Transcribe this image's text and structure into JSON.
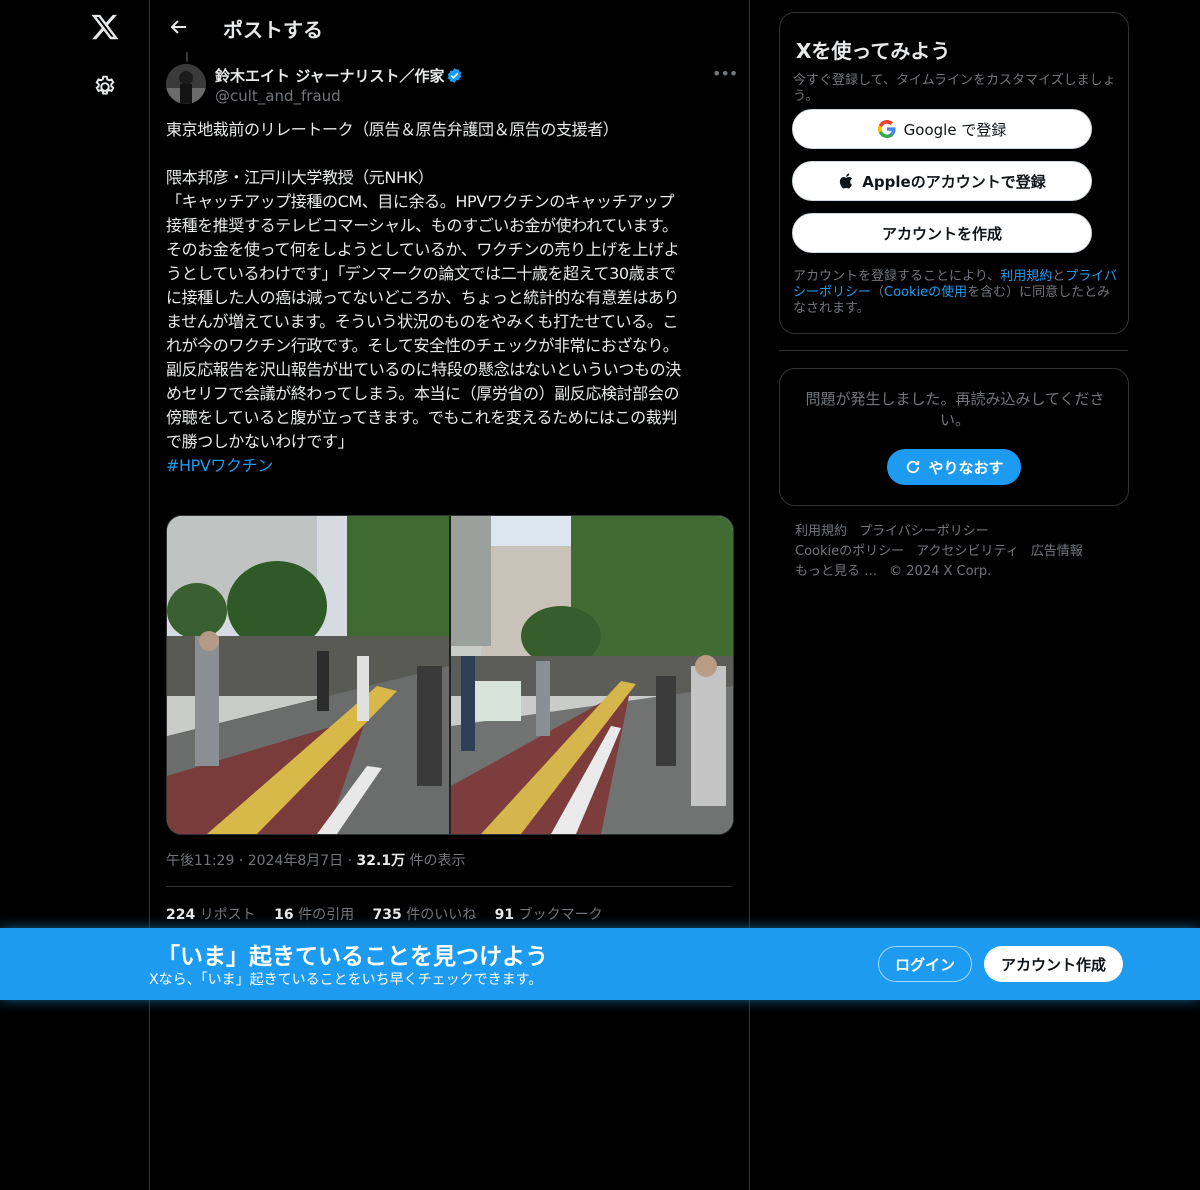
{
  "header": {
    "title": "ポストする"
  },
  "post": {
    "author_name": "鈴木エイト ジャーナリスト／作家",
    "author_handle": "@cult_and_fraud",
    "text": "東京地裁前のリレートーク（原告＆原告弁護団＆原告の支援者）\n\n隈本邦彦・江戸川大学教授（元NHK）\n「キャッチアップ接種のCM、目に余る。HPVワクチンのキャッチアップ\n接種を推奨するテレビコマーシャル、ものすごいお金が使われています。\nそのお金を使って何をしようとしているか、ワクチンの売り上げを上げよ\nうとしているわけです」「デンマークの論文では二十歳を超えて30歳まで\nに接種した人の癌は減ってないどころか、ちょっと統計的な有意差はあり\nませんが増えています。そういう状況のものをやみくも打たせている。こ\nれが今のワクチン行政です。そして安全性のチェックが非常におざなり。\n副反応報告を沢山報告が出ているのに特段の懸念はないといういつもの決\nめセリフで会議が終わってしまう。本当に（厚労省の）副反応検討部会の\n傍聴をしていると腹が立ってきます。でもこれを変えるためにはこの裁判\nで勝つしかないわけです」\n",
    "hashtag": "#HPVワクチン",
    "time": "午後11:29",
    "date": "2024年8月7日",
    "views_count": "32.1万",
    "views_label": "件の表示",
    "reposts_count": "224",
    "reposts_label": "リポスト",
    "quotes_count": "16",
    "quotes_label": "件の引用",
    "likes_count": "735",
    "likes_label": "件のいいね",
    "bookmarks_count": "91",
    "bookmarks_label": "ブックマーク"
  },
  "sidebar": {
    "signup_title": "Xを使ってみよう",
    "signup_sub": "今すぐ登録して、タイムラインをカスタマイズしましょう。",
    "google_label": "Google で登録",
    "apple_label": "Appleのアカウントで登録",
    "create_label": "アカウントを作成",
    "terms_prefix": "アカウントを登録することにより、",
    "terms_link": "利用規約",
    "terms_and": "と",
    "privacy_link": "プライバシーポリシー",
    "cookie_open": "（",
    "cookie_link": "Cookieの使用",
    "terms_suffix": "を含む）に同意したとみなされます。",
    "error_msg": "問題が発生しました。再読み込みしてください。",
    "retry_label": "やりなおす",
    "footer": {
      "terms": "利用規約",
      "privacy": "プライバシーポリシー",
      "cookie": "Cookieのポリシー",
      "accessibility": "アクセシビリティ",
      "ads": "広告情報",
      "more": "もっと見る …",
      "copyright": "© 2024 X Corp."
    }
  },
  "banner": {
    "title": "「いま」起きていることを見つけよう",
    "subtitle": "Xなら、「いま」起きていることをいち早くチェックできます。",
    "login_label": "ログイン",
    "create_label": "アカウント作成"
  },
  "colors": {
    "accent": "#1d9bf0",
    "background": "#000000",
    "text": "#e7e9ea",
    "muted": "#71767b",
    "border": "#2f3336"
  }
}
